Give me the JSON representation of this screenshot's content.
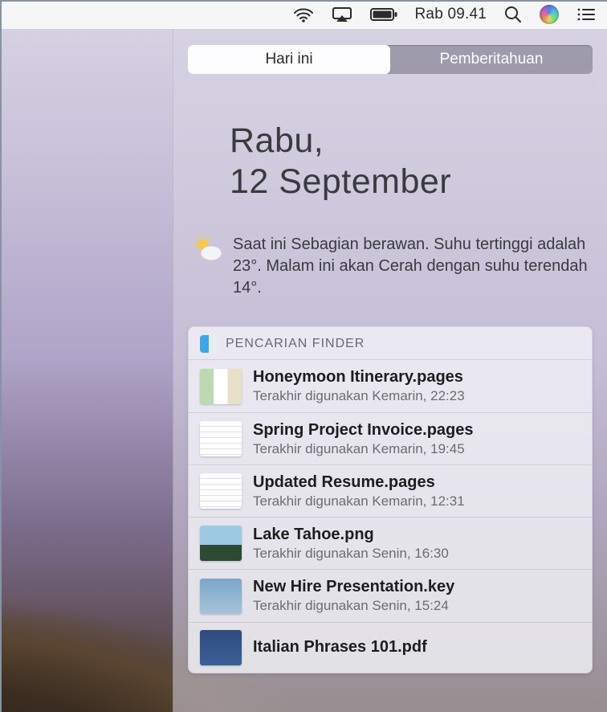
{
  "menubar": {
    "clock_text": "Rab 09.41"
  },
  "nc": {
    "tabs": {
      "today": "Hari ini",
      "notifications": "Pemberitahuan"
    },
    "date_line1": "Rabu,",
    "date_line2": "12 September",
    "weather_text": "Saat ini Sebagian berawan. Suhu tertinggi adalah 23°. Malam ini akan Cerah dengan suhu terendah 14°."
  },
  "finder_widget": {
    "title": "PENCARIAN FINDER",
    "files": [
      {
        "name": "Honeymoon Itinerary.pages",
        "subtitle": "Terakhir digunakan Kemarin, 22:23",
        "thumb": "brochure"
      },
      {
        "name": "Spring Project Invoice.pages",
        "subtitle": "Terakhir digunakan Kemarin, 19:45",
        "thumb": "doc"
      },
      {
        "name": "Updated Resume.pages",
        "subtitle": "Terakhir digunakan Kemarin, 12:31",
        "thumb": "doc"
      },
      {
        "name": "Lake Tahoe.png",
        "subtitle": "Terakhir digunakan Senin, 16:30",
        "thumb": "img"
      },
      {
        "name": "New Hire Presentation.key",
        "subtitle": "Terakhir digunakan Senin, 15:24",
        "thumb": "key"
      },
      {
        "name": "Italian Phrases 101.pdf",
        "subtitle": "",
        "thumb": "pdf"
      }
    ]
  }
}
